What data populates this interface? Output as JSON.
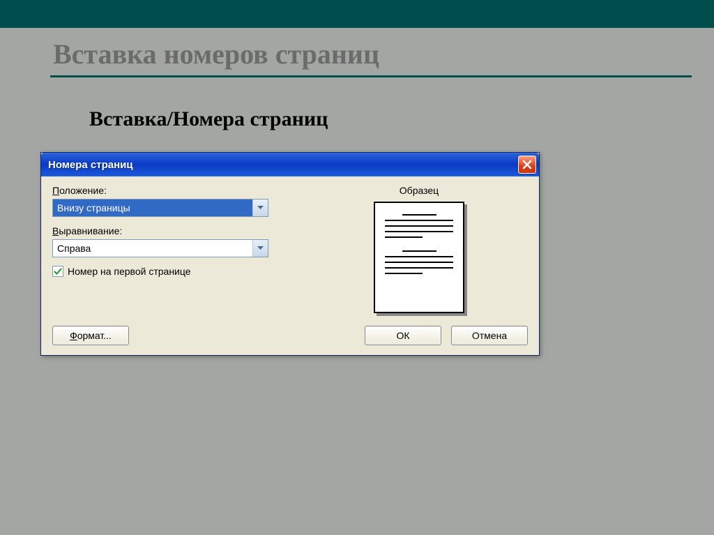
{
  "slide": {
    "heading": "Вставка номеров страниц",
    "subheading": "Вставка/Номера страниц"
  },
  "dialog": {
    "title": "Номера страниц",
    "position_label_pre": "П",
    "position_label_post": "оложение:",
    "position_value": "Внизу страницы",
    "alignment_label_pre": "В",
    "alignment_label_post": "ыравнивание:",
    "alignment_value": "Справа",
    "checkbox_label_pre": "Н",
    "checkbox_label_post": "омер на первой странице",
    "sample_label": "Образец",
    "format_btn_pre": "Ф",
    "format_btn_post": "ормат...",
    "ok_btn": "ОК",
    "cancel_btn": "Отмена"
  }
}
